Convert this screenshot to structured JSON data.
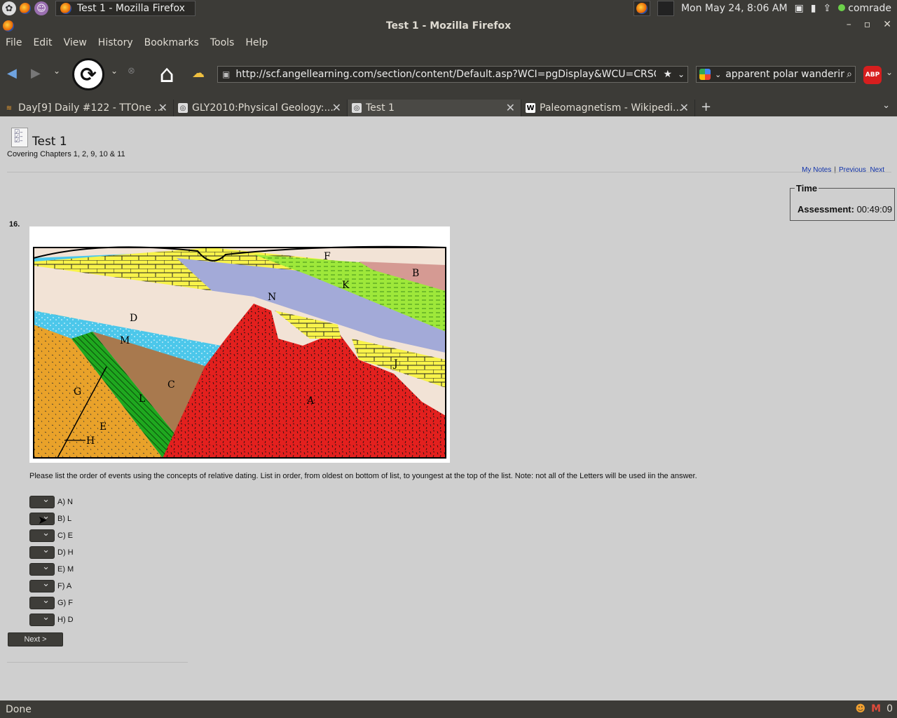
{
  "panel": {
    "task_title": "Test 1 - Mozilla Firefox",
    "clock": "Mon May 24,  8:06 AM",
    "user": "comrade"
  },
  "window": {
    "title": "Test 1 - Mozilla Firefox"
  },
  "menu": [
    "File",
    "Edit",
    "View",
    "History",
    "Bookmarks",
    "Tools",
    "Help"
  ],
  "url": "http://scf.angellearning.com/section/content/Default.asp?WCI=pgDisplay&WCU=CRSCNT&EN",
  "search": {
    "value": "apparent polar wandering"
  },
  "tabs": [
    {
      "label": "Day[9] Daily #122 - TTOne ..."
    },
    {
      "label": "GLY2010:Physical Geology:..."
    },
    {
      "label": "Test 1"
    },
    {
      "label": "Paleomagnetism - Wikipedi..."
    }
  ],
  "page": {
    "title": "Test 1",
    "subtitle": "Covering Chapters 1, 2, 9, 10 & 11",
    "links": {
      "notes": "My Notes",
      "sep": "|",
      "previous": "Previous",
      "next": "Next"
    },
    "time": {
      "legend": "Time",
      "label": "Assessment:",
      "value": "00:49:09"
    },
    "question_number": "16.",
    "instructions": "Please list the order of events using the concepts of relative dating. List in order, from oldest on bottom of list, to youngest at the top of the list.  Note: not all of the Letters will be used iin the answer.",
    "answers": [
      "A) N",
      "B) L",
      "C) E",
      "D) H",
      "E) M",
      "F) A",
      "G) F",
      "H) D"
    ],
    "next_button": "Next >",
    "figure_labels": [
      "F",
      "B",
      "K",
      "N",
      "D",
      "M",
      "C",
      "G",
      "L",
      "A",
      "J",
      "E",
      "H"
    ]
  },
  "status": {
    "text": "Done",
    "mail_count": "0"
  }
}
